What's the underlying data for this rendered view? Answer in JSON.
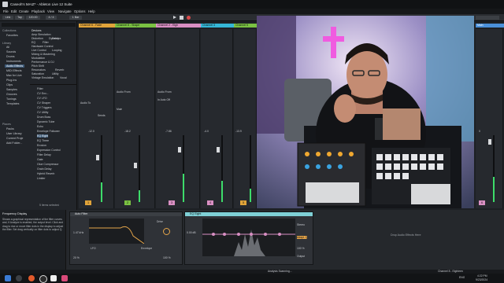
{
  "window": {
    "title": "Caseoh's MAIZ* - Ableton Live 12 Suite"
  },
  "menu": [
    "File",
    "Edit",
    "Create",
    "Playback",
    "View",
    "Navigate",
    "Options",
    "Help"
  ],
  "transport": {
    "link": "Link",
    "tap": "Tap",
    "tempo": "120.00",
    "sig": "4 / 4",
    "bars": "1 Bar"
  },
  "browser": {
    "collections_label": "Collections",
    "collections": [
      "Favorites"
    ],
    "library_label": "Library",
    "library": [
      "All",
      "Sounds",
      "Drums",
      "Instruments",
      "Audio Effects",
      "MIDI Effects",
      "Max for Live",
      "Plug-Ins",
      "Clips",
      "Samples",
      "Grooves",
      "Tunings",
      "Templates"
    ],
    "places_label": "Places",
    "places": [
      "Packs",
      "User Library",
      "Current Proje",
      "Add Folder..."
    ],
    "categories": [
      "Devices",
      "Amp Simulation",
      "Delay",
      "Distortion",
      "Dynamics",
      "EQ",
      "Filter",
      "Gate",
      "Hardware Control",
      "Live Control",
      "Looping",
      "Mixing & Mastering",
      "Modulation",
      "Modulator",
      "Performance & DJ",
      "Pitch & Modulation",
      "Pitch Shift",
      "Resonators",
      "Reverb",
      "Saturation",
      "Utility",
      "Vintage Emulation",
      "Vocal"
    ],
    "files": [
      "Filter",
      "CV Env...",
      "CV LFO",
      "CV Shaper",
      "CV Triggers",
      "CV Utility",
      "Drum Buss",
      "Dynamic Tube",
      "Echo",
      "Envelope Follower",
      "EQ Eight",
      "EQ Three",
      "Erosion",
      "Expression Control",
      "Filter Delay",
      "Gate",
      "Glue Compressor",
      "Grain Delay",
      "Hybrid Reverb",
      "Limiter"
    ],
    "footer": "5 items selected"
  },
  "tracks": [
    {
      "name": "Channel 6 - Fade",
      "color": "#e0a33a"
    },
    {
      "name": "Channel 8 - Shape",
      "color": "#7ac142"
    },
    {
      "name": "Channel 2 - Elgh",
      "color": "#d98fc3"
    },
    {
      "name": "Channel 3",
      "color": "#35b6d6"
    },
    {
      "name": "Channel 5",
      "color": "#7ac142"
    },
    {
      "name": "Main",
      "color": "#4a90d9"
    }
  ],
  "strip_labels": {
    "audio_from": "Audio From",
    "monitor": "In Auto Off",
    "audio_to": "Audio To",
    "main": "Main",
    "sends": "Sends"
  },
  "strip_values": [
    {
      "vol": "-12.0",
      "num": "1",
      "meter": 0.3
    },
    {
      "vol": "-18.2",
      "num": "2",
      "meter": 0.18
    },
    {
      "vol": "-7.86",
      "num": "3",
      "meter": 0.42
    },
    {
      "vol": "-4.0",
      "num": "4",
      "meter": 0.32
    },
    {
      "vol": "-13.9",
      "num": "5",
      "meter": 0.2
    },
    {
      "vol": "0",
      "num": "6",
      "meter": 0.38
    }
  ],
  "info": {
    "title": "Frequency Display",
    "body": "Shows a graphical representation of the filter curves and, if Analyze is enabled, the output level. Click and drag to rise or move filter dots in the display to adjust the filter. Set drag vertically on filter dots to adjust Q."
  },
  "devices": {
    "auto_filter": {
      "title": "Auto Filter",
      "freq": "1.47 kHz",
      "res": "20 %",
      "lfo": "LFO",
      "env": "Envelope",
      "drive": "Drive",
      "mix": "100 %"
    },
    "eq_eight": {
      "title": "EQ Eight",
      "adapt": "Adapt. Q",
      "gain": "0.00 dB",
      "scale": "100 %",
      "mode": "Stereo",
      "out": "Output"
    },
    "drop": "Drop Audio Effects Here"
  },
  "status": {
    "left": "Analysis Scanning...",
    "track": "Channel 8 - Eighteen"
  },
  "taskbar": {
    "time": "4:22 PM",
    "date": "9/23/2024",
    "lang": "ENG"
  }
}
